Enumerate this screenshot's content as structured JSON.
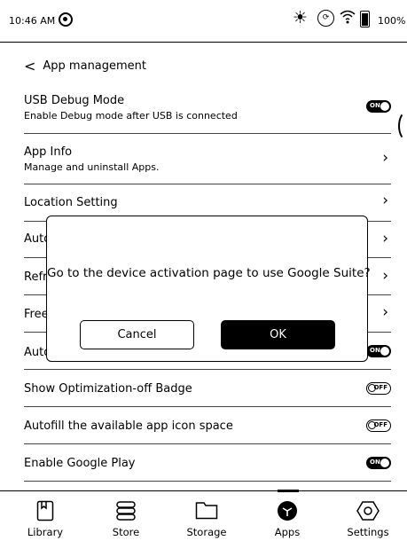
{
  "status_bar": {
    "time": "10:46 AM",
    "battery_text": "100%",
    "icons": [
      "app-badge-icon",
      "frontlight-sun-icon",
      "refresh-icon",
      "wifi-icon",
      "battery-icon"
    ]
  },
  "header": {
    "back_glyph": "<",
    "title": "App management"
  },
  "settings": {
    "usb_debug": {
      "label": "USB Debug Mode",
      "sub": "Enable Debug mode after USB is connected",
      "state": "ON"
    },
    "app_info": {
      "label": "App Info",
      "sub": "Manage and uninstall Apps."
    },
    "location": {
      "label": "Location Setting"
    },
    "row4": {
      "label": "Auto"
    },
    "row5": {
      "label": "Refr"
    },
    "row6": {
      "label": "Free"
    },
    "row7": {
      "label": "Auto",
      "state": "ON"
    },
    "optimization_badge": {
      "label": "Show Optimization-off Badge",
      "state": "OFF"
    },
    "autofill": {
      "label": "Autofill the available app icon space",
      "state": "OFF"
    },
    "google_play": {
      "label": "Enable Google Play",
      "state": "ON"
    }
  },
  "dialog": {
    "message": "Go to the device activation page to use Google Suite?",
    "cancel_label": "Cancel",
    "ok_label": "OK"
  },
  "tabs": [
    {
      "label": "Library",
      "icon": "book-icon",
      "active": false
    },
    {
      "label": "Store",
      "icon": "store-icon",
      "active": false
    },
    {
      "label": "Storage",
      "icon": "folder-icon",
      "active": false
    },
    {
      "label": "Apps",
      "icon": "apps-cube-icon",
      "active": true
    },
    {
      "label": "Settings",
      "icon": "gear-icon",
      "active": false
    }
  ]
}
